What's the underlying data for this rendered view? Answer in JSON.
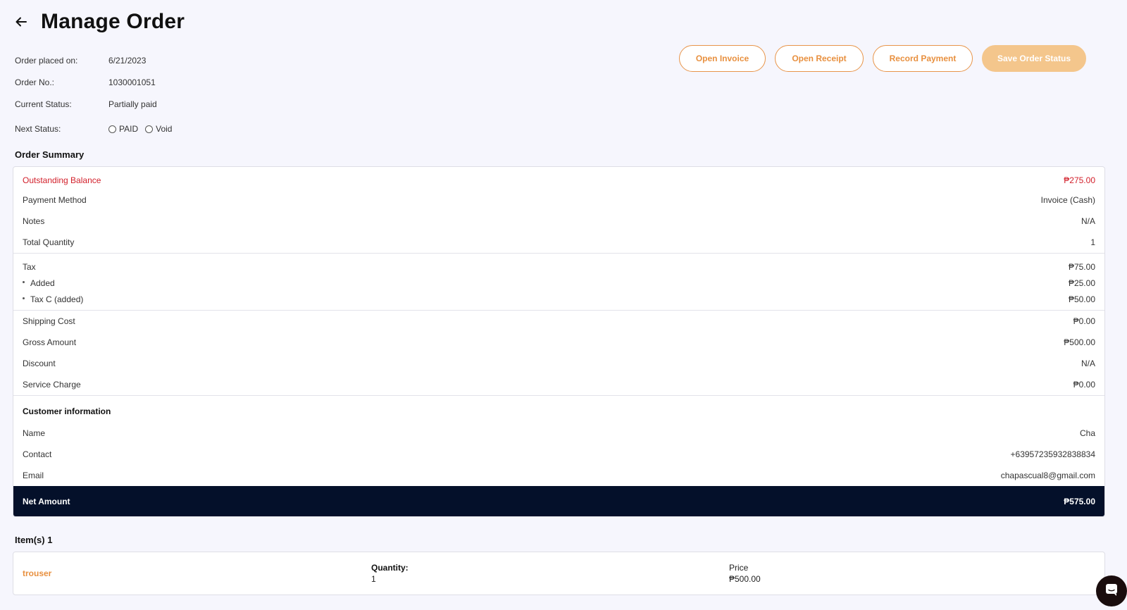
{
  "header": {
    "title": "Manage Order"
  },
  "order": {
    "placed_label": "Order placed on:",
    "placed_value": "6/21/2023",
    "no_label": "Order No.:",
    "no_value": "1030001051",
    "status_label": "Current Status:",
    "status_value": "Partially paid",
    "next_label": "Next Status:",
    "next_options": [
      "PAID",
      "Void"
    ]
  },
  "actions": {
    "open_invoice": "Open Invoice",
    "open_receipt": "Open Receipt",
    "record_payment": "Record Payment",
    "save_status": "Save Order Status"
  },
  "summary": {
    "title": "Order Summary",
    "outstanding_label": "Outstanding Balance",
    "outstanding_value": "₱275.00",
    "payment_method_label": "Payment Method",
    "payment_method_value": "Invoice (Cash)",
    "notes_label": "Notes",
    "notes_value": "N/A",
    "total_qty_label": "Total Quantity",
    "total_qty_value": "1",
    "tax_label": "Tax",
    "tax_value": "₱75.00",
    "tax_items": [
      {
        "label": "Added",
        "value": "₱25.00"
      },
      {
        "label": "Tax C (added)",
        "value": "₱50.00"
      }
    ],
    "shipping_label": "Shipping Cost",
    "shipping_value": "₱0.00",
    "gross_label": "Gross Amount",
    "gross_value": "₱500.00",
    "discount_label": "Discount",
    "discount_value": "N/A",
    "service_label": "Service Charge",
    "service_value": "₱0.00",
    "customer_title": "Customer information",
    "name_label": "Name",
    "name_value": "Cha",
    "contact_label": "Contact",
    "contact_value": "+63957235932838834",
    "email_label": "Email",
    "email_value": "chapascual8@gmail.com",
    "net_label": "Net Amount",
    "net_value": "₱575.00"
  },
  "items": {
    "title": "Item(s) 1",
    "list": [
      {
        "name": "trouser",
        "qty_label": "Quantity:",
        "qty": "1",
        "price_label": "Price",
        "price": "₱500.00"
      }
    ]
  },
  "colors": {
    "accent": "#e8903f",
    "accent_light": "#f4c68c",
    "danger": "#d21f2a",
    "net_bg": "#04102a"
  }
}
